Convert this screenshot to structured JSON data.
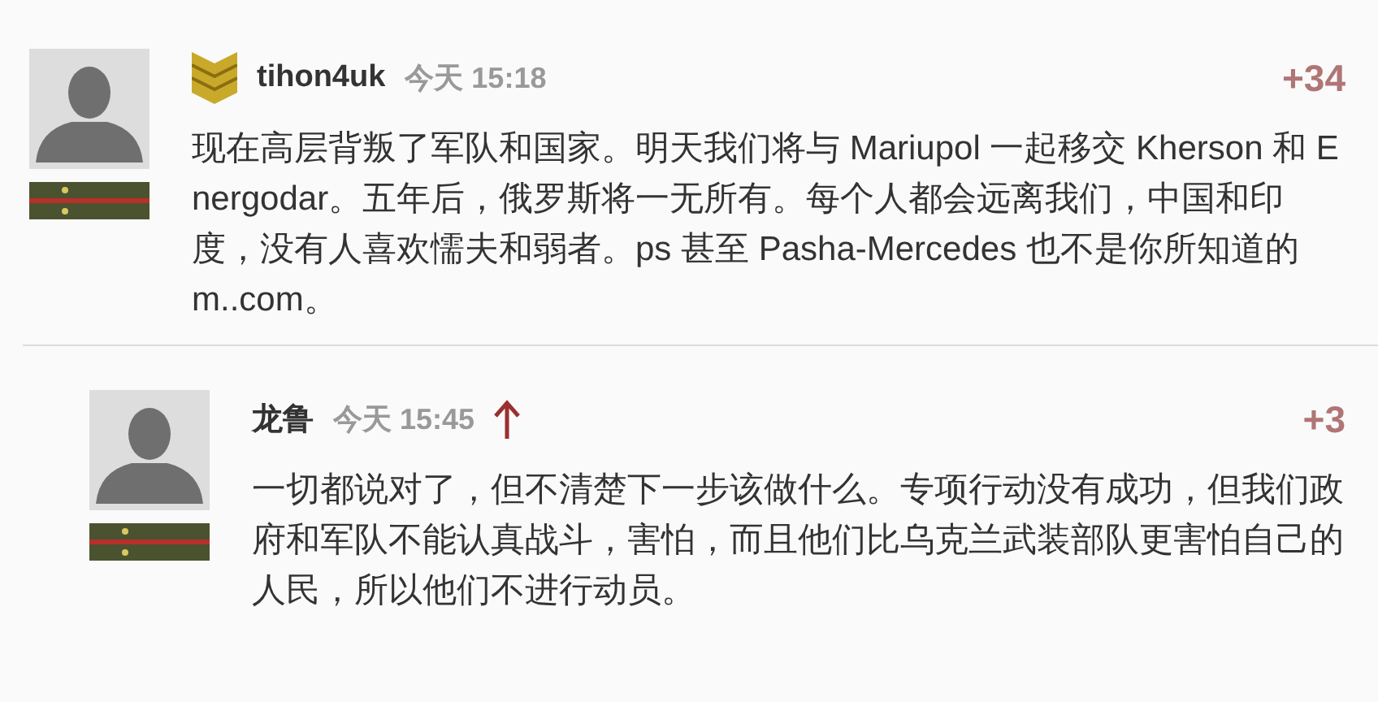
{
  "comments": [
    {
      "author": "tihon4uk",
      "time": "今天 15:18",
      "score": "+34",
      "rank_chevron": true,
      "up_arrow": false,
      "text": "现在高层背叛了军队和国家。明天我们将与 Mariupol 一起移交 Kherson 和 Energodar。五年后，俄罗斯将一无所有。每个人都会远离我们，中国和印度，没有人喜欢懦夫和弱者。ps 甚至 Pasha-Mercedes 也不是你所知道的 m..com。"
    },
    {
      "author": "龙鲁",
      "time": "今天 15:45",
      "score": "+3",
      "rank_chevron": false,
      "up_arrow": true,
      "text": "一切都说对了，但不清楚下一步该做什么。专项行动没有成功，但我们政府和军队不能认真战斗，害怕，而且他们比乌克兰武装部队更害怕自己的人民，所以他们不进行动员。"
    }
  ]
}
